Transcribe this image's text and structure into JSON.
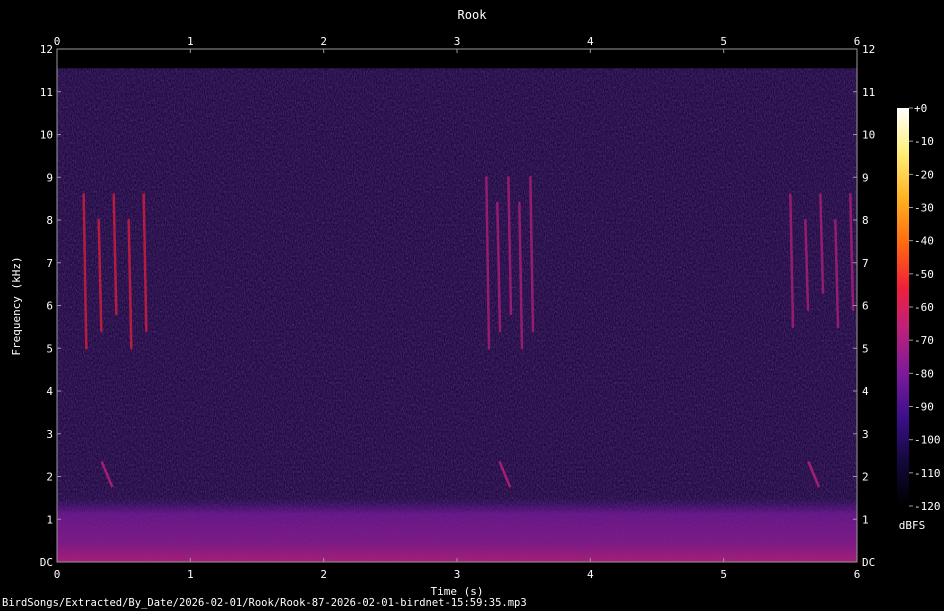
{
  "chart_data": {
    "type": "heatmap",
    "title": "Rook",
    "xlabel": "Time (s)",
    "ylabel": "Frequency (kHz)",
    "xlim": [
      0,
      6
    ],
    "ylim": [
      0,
      12
    ],
    "x_ticks": [
      "0",
      "1",
      "2",
      "3",
      "4",
      "5",
      "6"
    ],
    "y_ticks": [
      "DC",
      "1",
      "2",
      "3",
      "4",
      "5",
      "6",
      "7",
      "8",
      "9",
      "10",
      "11",
      "12"
    ],
    "colorbar": {
      "label": "dBFS",
      "range": [
        -120,
        0
      ],
      "ticks": [
        "+0",
        "-10",
        "-20",
        "-30",
        "-40",
        "-50",
        "-60",
        "-70",
        "-80",
        "-90",
        "-100",
        "-110",
        "-120"
      ],
      "colors": [
        "#000000",
        "#12083a",
        "#3a0f8a",
        "#7a1a9a",
        "#c0207a",
        "#f0203a",
        "#ff6a10",
        "#ffb020",
        "#fff07a",
        "#ffffff"
      ]
    },
    "calls": [
      {
        "t_start": 0.2,
        "t_end": 0.65,
        "f_low_khz": 5.0,
        "f_high_khz": 8.6,
        "level_dbfs": -60
      },
      {
        "t_start": 3.22,
        "t_end": 3.55,
        "f_low_khz": 5.0,
        "f_high_khz": 9.0,
        "level_dbfs": -65
      },
      {
        "t_start": 5.5,
        "t_end": 5.95,
        "f_low_khz": 5.5,
        "f_high_khz": 8.6,
        "level_dbfs": -65
      }
    ],
    "noise_band_khz": [
      0,
      1.5
    ],
    "source_file": "BirdSongs/Extracted/By_Date/2026-02-01/Rook/Rook-87-2026-02-01-birdnet-15:59:35.mp3"
  }
}
